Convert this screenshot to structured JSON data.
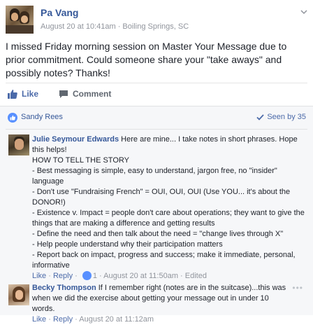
{
  "post": {
    "author": "Pa Vang",
    "timestamp": "August 20 at 10:41am",
    "separator": " · ",
    "location": "Boiling Springs, SC",
    "text": "I missed Friday morning session on Master Your Message due to prior commitment. Could someone share your \"take aways\" and possibly notes? Thanks!"
  },
  "actions": {
    "like_label": "Like",
    "comment_label": "Comment"
  },
  "reactions": {
    "liker": "Sandy Rees",
    "seen_by": "Seen by 35"
  },
  "comments": [
    {
      "author": "Julie Seymour Edwards",
      "lines": [
        "Here are mine... I take notes in short phrases. Hope this helps!",
        "HOW TO TELL THE STORY",
        "- Best messaging is simple, easy to understand, jargon free, no \"insider\" language",
        "- Don't use \"Fundraising French\" = OUI, OUI, OUI (Use YOU... it's about the DONOR!)",
        "- Existence v. Impact = people don't care about operations; they want to give the things that are making a difference and getting results",
        "- Define the need and then talk about the need = \"change lives through X\"",
        "- Help people understand why their participation matters",
        "- Report back on impact, progress and success; make it immediate, personal, informative"
      ],
      "like": "Like",
      "reply": "Reply",
      "sep": " · ",
      "like_count": "1",
      "time": "August 20 at 11:50am",
      "edited": "Edited"
    },
    {
      "author": "Becky Thompson",
      "text": "If I remember right (notes are in the suitcase)...this was when we did the exercise about getting your message out in under 10 words.",
      "like": "Like",
      "reply": "Reply",
      "sep": " · ",
      "time": "August 20 at 11:12am",
      "more": "•••"
    }
  ],
  "colors": {
    "link": "#365899",
    "meta": "#90949c",
    "like_blue": "#5890ff",
    "comments_bg": "#f6f7f9"
  }
}
